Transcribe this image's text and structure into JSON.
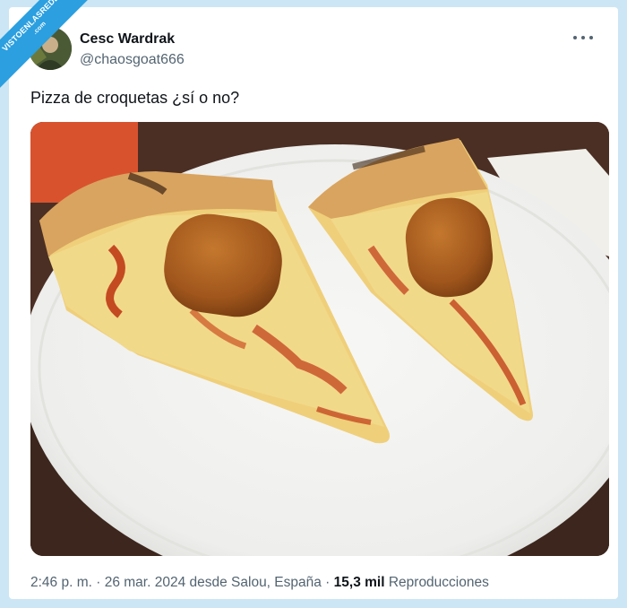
{
  "watermark": {
    "text": "VISTOENLASREDES",
    "sub": ".com"
  },
  "user": {
    "name": "Cesc Wardrak",
    "handle": "@chaosgoat666"
  },
  "tweet": {
    "text": "Pizza de croquetas ¿sí o no?"
  },
  "meta": {
    "time": "2:46 p. m.",
    "separator": " · ",
    "date_place": "26 mar. 2024 desde Salou, España",
    "views_count": "15,3 mil",
    "views_label": "Reproducciones"
  },
  "icons": {
    "more": "more-horizontal-icon"
  },
  "colors": {
    "background": "#cde6f5",
    "text": "#0f1419",
    "muted": "#536471",
    "watermark": "#2b9fe0"
  }
}
